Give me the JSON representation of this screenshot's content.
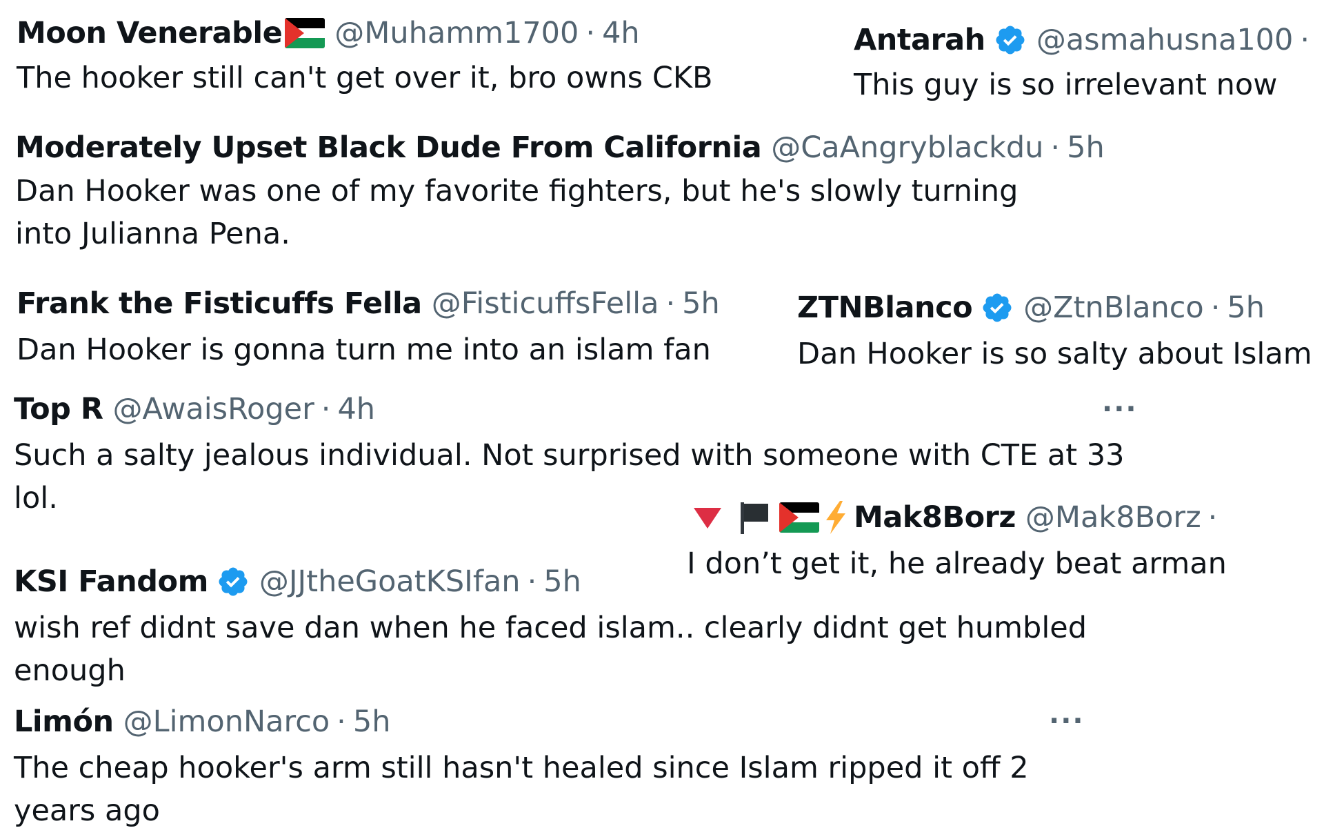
{
  "colors": {
    "name": "#0f1419",
    "meta": "#536471",
    "verified": "#1d9bf0",
    "flag_red": "#e4312b",
    "flag_green": "#149954",
    "bolt": "#ffac33",
    "red_triangle": "#dd2e44"
  },
  "separator": "·",
  "more_label": "···",
  "tweets": [
    {
      "name": "Moon Venerable",
      "handle": "@Muhamm1700",
      "time": "4h",
      "text": "The hooker still can't get over it, bro owns CKB",
      "icons": [
        "palestine-flag-icon"
      ]
    },
    {
      "name": "Antarah",
      "handle": "@asmahusna100",
      "time": "",
      "text": "This guy is so irrelevant now",
      "icons": [
        "verified-badge-icon"
      ]
    },
    {
      "name": "Moderately Upset Black Dude From California",
      "handle": "@CaAngryblackdu",
      "time": "5h",
      "text": "Dan Hooker was one of my favorite fighters, but he's slowly turning into Julianna Pena.",
      "icons": []
    },
    {
      "name": "Frank the Fisticuffs Fella",
      "handle": "@FisticuffsFella",
      "time": "5h",
      "text": "Dan Hooker is gonna turn me into an islam fan",
      "icons": []
    },
    {
      "name": "ZTNBlanco",
      "handle": "@ZtnBlanco",
      "time": "5h",
      "text": "Dan Hooker is so salty about Islam",
      "icons": [
        "verified-badge-icon"
      ]
    },
    {
      "name": "Top R",
      "handle": "@AwaisRoger",
      "time": "4h",
      "text": "Such a salty jealous individual. Not surprised with someone with CTE at 33 lol.",
      "icons": [
        "more-icon"
      ]
    },
    {
      "name": "Mak8Borz",
      "handle": "@Mak8Borz",
      "time": "",
      "text": "I don’t get it, he already beat arman",
      "icons": [
        "red-triangle-icon",
        "black-flag-icon",
        "palestine-flag-icon",
        "lightning-icon"
      ]
    },
    {
      "name": "KSI Fandom",
      "handle": "@JJtheGoatKSIfan",
      "time": "5h",
      "text": "wish ref didnt save dan when he faced islam.. clearly didnt get humbled enough",
      "icons": [
        "verified-badge-icon"
      ]
    },
    {
      "name": "Limón",
      "handle": "@LimonNarco",
      "time": "5h",
      "text": "The cheap hooker's arm still hasn't healed since Islam ripped it off 2 years ago",
      "icons": [
        "more-icon"
      ]
    }
  ]
}
